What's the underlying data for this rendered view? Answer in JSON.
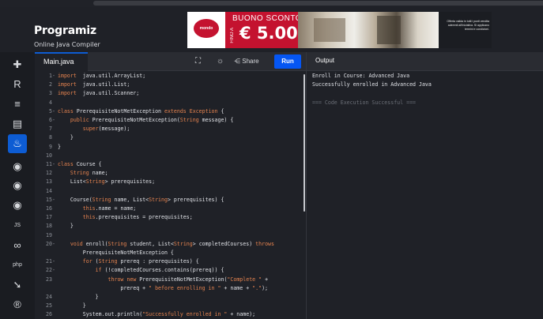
{
  "brand": {
    "name": "Programiz",
    "subtitle": "Online Java Compiler"
  },
  "ad": {
    "title": "BUONO SCONTO",
    "prefix": "FINO A",
    "amount": "€ 5.000",
    "logo": "mondo",
    "fine_print": "Offerta valida in tutti i punti vendita aderenti all'iniziativa. Si applicano termini e condizioni."
  },
  "sidebar": {
    "items": [
      {
        "icon": "python-icon",
        "glyph": "✚"
      },
      {
        "icon": "r-icon",
        "glyph": "R"
      },
      {
        "icon": "sql-icon",
        "glyph": "≡"
      },
      {
        "icon": "html-icon",
        "glyph": "▤"
      },
      {
        "icon": "java-icon",
        "glyph": "♨"
      },
      {
        "icon": "c-icon",
        "glyph": "◉"
      },
      {
        "icon": "cpp-icon",
        "glyph": "◉"
      },
      {
        "icon": "csharp-icon",
        "glyph": "◉"
      },
      {
        "icon": "js-icon",
        "glyph": "JS"
      },
      {
        "icon": "go-icon",
        "glyph": "∞"
      },
      {
        "icon": "php-icon",
        "glyph": "php"
      },
      {
        "icon": "swift-icon",
        "glyph": "➘"
      },
      {
        "icon": "rust-icon",
        "glyph": "®"
      }
    ]
  },
  "editor": {
    "tab": "Main.java",
    "share_label": "Share",
    "run_label": "Run",
    "lines": [
      {
        "n": "1",
        "f": "-",
        "parts": [
          [
            "kw",
            "import"
          ],
          [
            "",
            "  java.util.ArrayList;"
          ]
        ]
      },
      {
        "n": "2",
        "f": "",
        "parts": [
          [
            "kw",
            "import"
          ],
          [
            "",
            "  java.util.List;"
          ]
        ]
      },
      {
        "n": "3",
        "f": "",
        "parts": [
          [
            "kw",
            "import"
          ],
          [
            "",
            "  java.util.Scanner;"
          ]
        ]
      },
      {
        "n": "4",
        "f": "",
        "parts": []
      },
      {
        "n": "5",
        "f": "-",
        "parts": [
          [
            "kw",
            "class"
          ],
          [
            "",
            " PrerequisiteNotMetException "
          ],
          [
            "kw",
            "extends"
          ],
          [
            "",
            " "
          ],
          [
            "ty",
            "Exception"
          ],
          [
            "",
            " {"
          ]
        ]
      },
      {
        "n": "6",
        "f": "-",
        "parts": [
          [
            "",
            "    "
          ],
          [
            "kw",
            "public"
          ],
          [
            "",
            " PrerequisiteNotMetException("
          ],
          [
            "ty",
            "String"
          ],
          [
            "",
            " message) {"
          ]
        ]
      },
      {
        "n": "7",
        "f": "",
        "parts": [
          [
            "",
            "        "
          ],
          [
            "kw",
            "super"
          ],
          [
            "",
            "(message);"
          ]
        ]
      },
      {
        "n": "8",
        "f": "",
        "parts": [
          [
            "",
            "    }"
          ]
        ]
      },
      {
        "n": "9",
        "f": "",
        "parts": [
          [
            "",
            "}"
          ]
        ]
      },
      {
        "n": "10",
        "f": "",
        "parts": []
      },
      {
        "n": "11",
        "f": "-",
        "parts": [
          [
            "kw",
            "class"
          ],
          [
            "",
            " Course {"
          ]
        ]
      },
      {
        "n": "12",
        "f": "",
        "parts": [
          [
            "",
            "    "
          ],
          [
            "ty",
            "String"
          ],
          [
            "",
            " name;"
          ]
        ]
      },
      {
        "n": "13",
        "f": "",
        "parts": [
          [
            "",
            "    List<"
          ],
          [
            "ty",
            "String"
          ],
          [
            "",
            "> prerequisites;"
          ]
        ]
      },
      {
        "n": "14",
        "f": "",
        "parts": []
      },
      {
        "n": "15",
        "f": "-",
        "parts": [
          [
            "",
            "    Course("
          ],
          [
            "ty",
            "String"
          ],
          [
            "",
            " name, List<"
          ],
          [
            "ty",
            "String"
          ],
          [
            "",
            "> prerequisites) {"
          ]
        ]
      },
      {
        "n": "16",
        "f": "",
        "parts": [
          [
            "",
            "        "
          ],
          [
            "kw",
            "this"
          ],
          [
            "",
            ".name = name;"
          ]
        ]
      },
      {
        "n": "17",
        "f": "",
        "parts": [
          [
            "",
            "        "
          ],
          [
            "kw",
            "this"
          ],
          [
            "",
            ".prerequisites = prerequisites;"
          ]
        ]
      },
      {
        "n": "18",
        "f": "",
        "parts": [
          [
            "",
            "    }"
          ]
        ]
      },
      {
        "n": "19",
        "f": "",
        "parts": []
      },
      {
        "n": "20",
        "f": "-",
        "parts": [
          [
            "",
            "    "
          ],
          [
            "kw",
            "void"
          ],
          [
            "",
            " enroll("
          ],
          [
            "ty",
            "String"
          ],
          [
            "",
            " student, List<"
          ],
          [
            "ty",
            "String"
          ],
          [
            "",
            "> completedCourses) "
          ],
          [
            "kw",
            "throws"
          ]
        ]
      },
      {
        "n": "",
        "f": "",
        "parts": [
          [
            "",
            "        PrerequisiteNotMetException {"
          ]
        ]
      },
      {
        "n": "21",
        "f": "-",
        "parts": [
          [
            "",
            "        "
          ],
          [
            "kw",
            "for"
          ],
          [
            "",
            " ("
          ],
          [
            "ty",
            "String"
          ],
          [
            "",
            " prereq : prerequisites) {"
          ]
        ]
      },
      {
        "n": "22",
        "f": "-",
        "parts": [
          [
            "",
            "            "
          ],
          [
            "kw",
            "if"
          ],
          [
            "",
            " (!completedCourses.contains(prereq)) {"
          ]
        ]
      },
      {
        "n": "23",
        "f": "",
        "parts": [
          [
            "",
            "                "
          ],
          [
            "kw",
            "throw"
          ],
          [
            "",
            " "
          ],
          [
            "kw",
            "new"
          ],
          [
            "",
            " PrerequisiteNotMetException("
          ],
          [
            "st",
            "\"Complete \""
          ],
          [
            "",
            " +"
          ]
        ]
      },
      {
        "n": "",
        "f": "",
        "parts": [
          [
            "",
            "                    prereq + "
          ],
          [
            "st",
            "\" before enrolling in \""
          ],
          [
            "",
            " + name + "
          ],
          [
            "st",
            "\".\""
          ],
          [
            "",
            ");"
          ]
        ]
      },
      {
        "n": "24",
        "f": "",
        "parts": [
          [
            "",
            "            }"
          ]
        ]
      },
      {
        "n": "25",
        "f": "",
        "parts": [
          [
            "",
            "        }"
          ]
        ]
      },
      {
        "n": "26",
        "f": "",
        "parts": [
          [
            "",
            "        System.out.println("
          ],
          [
            "st",
            "\"Successfully enrolled in \""
          ],
          [
            "",
            " + name);"
          ]
        ]
      }
    ]
  },
  "output": {
    "title": "Output",
    "lines": [
      {
        "text": "Enroll in Course: Advanced Java",
        "muted": false
      },
      {
        "text": "Successfully enrolled in Advanced Java",
        "muted": false
      },
      {
        "text": "",
        "muted": false
      },
      {
        "text": "=== Code Execution Successful ===",
        "muted": true
      }
    ]
  }
}
